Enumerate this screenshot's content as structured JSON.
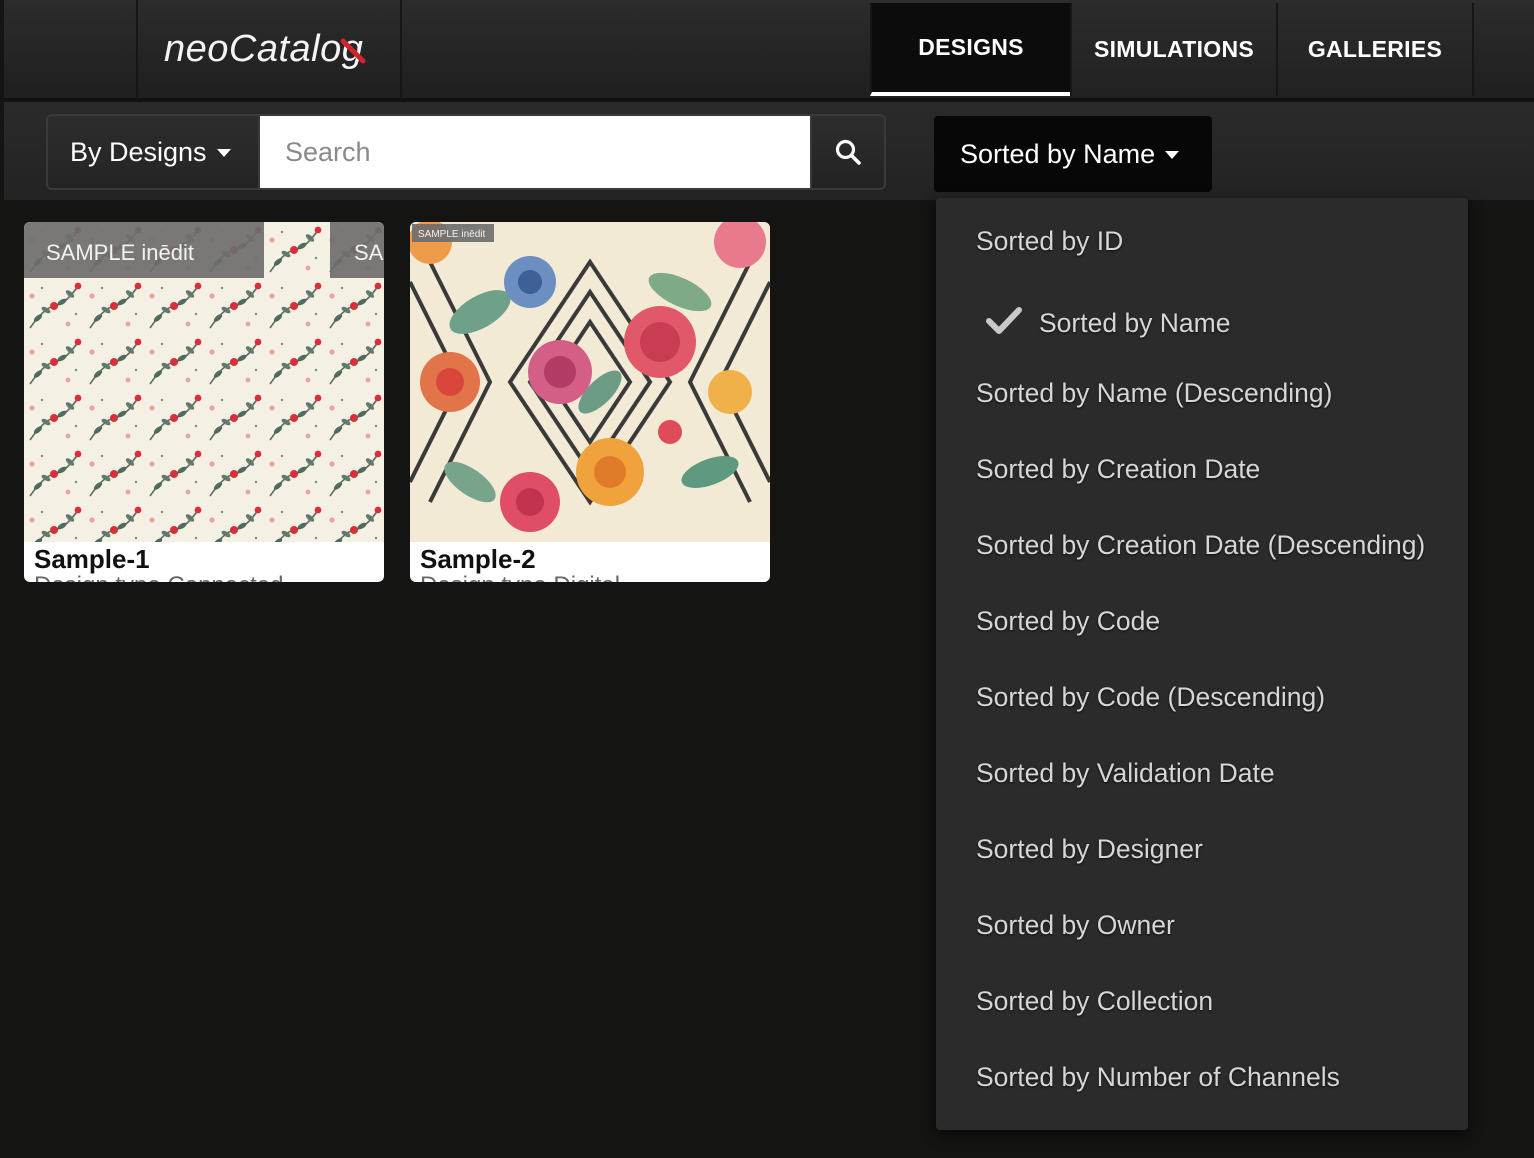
{
  "header": {
    "logo_text": "neoCatalog",
    "tabs": [
      {
        "label": "DESIGNS",
        "active": true
      },
      {
        "label": "SIMULATIONS",
        "active": false
      },
      {
        "label": "GALLERIES",
        "active": false
      }
    ]
  },
  "toolbar": {
    "filter_label": "By Designs",
    "search_placeholder": "Search",
    "search_icon": "search-icon",
    "sort_label": "Sorted by Name"
  },
  "cards": [
    {
      "name": "Sample-1",
      "subtitle": "Design type Connected",
      "watermark": "SAMPLE inēdit"
    },
    {
      "name": "Sample-2",
      "subtitle": "Design type Digital",
      "watermark": "SAMPLE inēdit"
    }
  ],
  "sort_menu": {
    "selected": "Sorted by Name",
    "items": [
      "Sorted by ID",
      "Sorted by Name",
      "Sorted by Name (Descending)",
      "Sorted by Creation Date",
      "Sorted by Creation Date (Descending)",
      "Sorted by Code",
      "Sorted by Code (Descending)",
      "Sorted by Validation Date",
      "Sorted by Designer",
      "Sorted by Owner",
      "Sorted by Collection",
      "Sorted by Number of Channels"
    ]
  },
  "colors": {
    "background": "#141413",
    "header": "#262626",
    "menu": "#2b2b2b",
    "active_tab": "#0c0c0c",
    "accent_red": "#d3232b"
  }
}
